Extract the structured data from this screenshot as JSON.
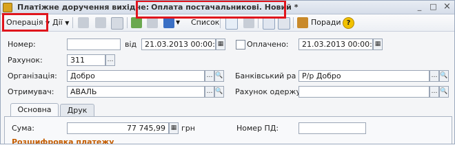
{
  "window": {
    "title_main": "Платіжне доручення вихідне:",
    "title_highlight": "Оплата постачальникові. Новий *",
    "minimize": "_",
    "maximize": "□",
    "close": "×"
  },
  "toolbar": {
    "operation": "Операція",
    "actions": "Дії",
    "list": "Список",
    "tips": "Поради",
    "help": "?"
  },
  "form": {
    "number_label": "Номер:",
    "number_value": "",
    "date_from_label": "від",
    "date_value": "21.03.2013 00:00:00",
    "paid_label": "Оплачено:",
    "paid_date_value": "21.03.2013 00:00:00",
    "account_label": "Рахунок:",
    "account_value": "311",
    "organization_label": "Організація:",
    "organization_value": "Добро",
    "bank_account_label": "Банківський ра",
    "bank_account_value": "Р/р Добро",
    "recipient_label": "Отримувач:",
    "recipient_value": "АВАЛЬ",
    "recipient_account_label": "Рахунок одержу...",
    "recipient_account_value": ""
  },
  "tabs": [
    {
      "label": "Основна"
    },
    {
      "label": "Друк"
    }
  ],
  "main_tab": {
    "sum_label": "Сума:",
    "sum_value": "77 745,99",
    "currency": "грн",
    "vat_number_label": "Номер ПД:",
    "vat_number_value": "",
    "section_title": "Розшифровка платежу"
  }
}
